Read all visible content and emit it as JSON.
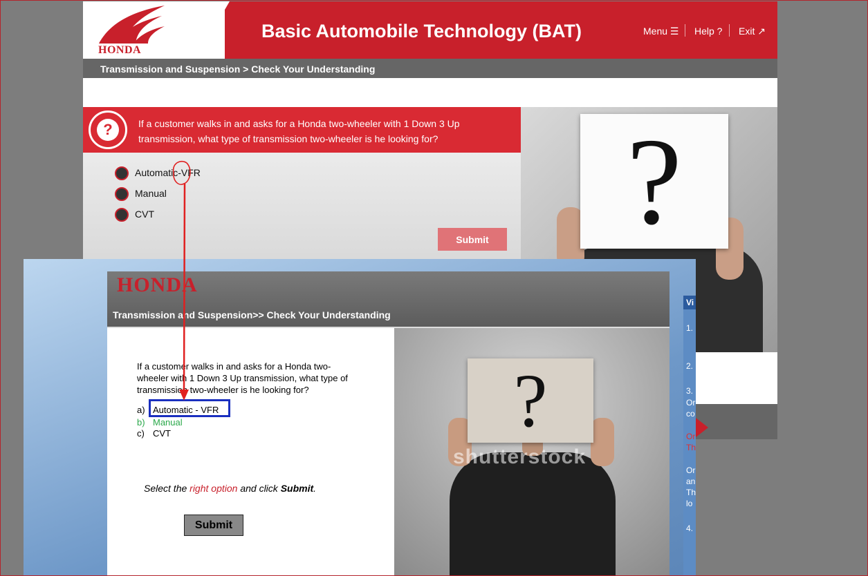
{
  "new_screen": {
    "logo_text": "HONDA",
    "title": "Basic Automobile Technology (BAT)",
    "nav": {
      "menu": "Menu ☰",
      "help": "Help ?",
      "exit": "Exit ↗"
    },
    "breadcrumb": "Transmission and Suspension > Check Your Understanding",
    "question": "If a customer walks in and asks for a Honda two-wheeler with 1 Down 3 Up transmission, what type of transmission two-wheeler is he looking for?",
    "options": [
      "Automatic-VFR",
      "Manual",
      "CVT"
    ],
    "submit_label": "Submit",
    "question_icon_glyph": "?",
    "photo_glyph": "?"
  },
  "old_screen": {
    "logo_text": "HONDA",
    "breadcrumb": "Transmission and Suspension>> Check Your Understanding",
    "question": "If a customer walks in and asks for a Honda two-wheeler with 1 Down 3 Up transmission, what type of transmission two-wheeler is he looking for?",
    "options": [
      {
        "letter": "a)",
        "label": "Automatic - VFR",
        "color": "#000000"
      },
      {
        "letter": "b)",
        "label": "Manual",
        "color": "#2aa84a"
      },
      {
        "letter": "c)",
        "label": "CVT",
        "color": "#000000"
      }
    ],
    "instruction": {
      "part1": "Select the ",
      "part2": "right option",
      "part3": " and click ",
      "part4": "Submit",
      "part5": "."
    },
    "submit_label": "Submit",
    "photo_glyph": "?",
    "watermark": "shutterstock"
  },
  "side_panel": {
    "header": "Vi",
    "items": [
      "1.",
      "2.",
      "3.",
      "Or",
      "co",
      "Or",
      "Th",
      "Or",
      "an",
      "Th",
      "lo",
      "4."
    ]
  },
  "colors": {
    "brand_red": "#c8202b",
    "highlight_box": "#1a2fbf",
    "annotation": "#e02020"
  }
}
